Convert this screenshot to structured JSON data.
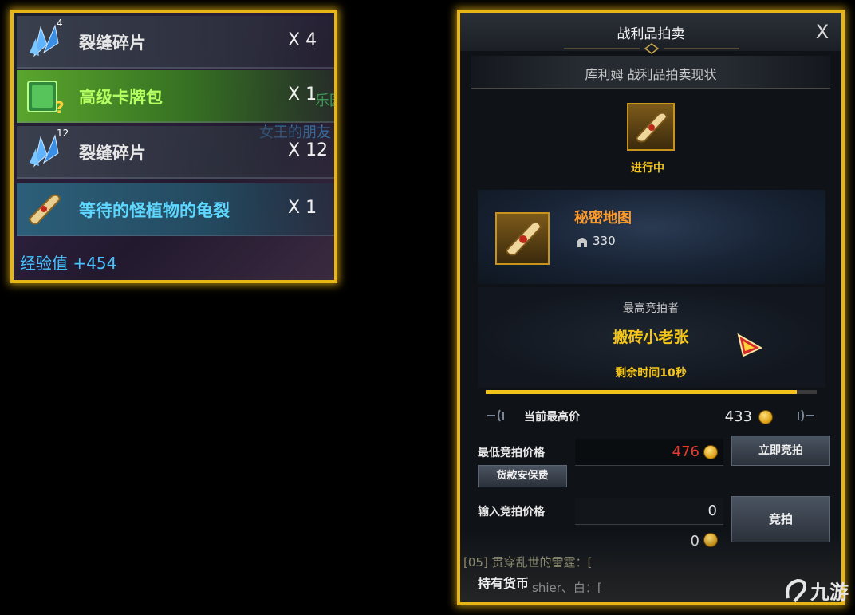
{
  "loot_panel": {
    "rows": [
      {
        "icon": "crystal-shard-icon",
        "badge": "4",
        "name": "裂缝碎片",
        "qty": "X 4"
      },
      {
        "icon": "card-pack-icon",
        "badge": "",
        "name": "高级卡牌包",
        "qty": "X 1"
      },
      {
        "icon": "crystal-shard-icon",
        "badge": "12",
        "name": "裂缝碎片",
        "qty": "X 12"
      },
      {
        "icon": "scroll-icon",
        "badge": "",
        "name": "等待的怪植物的龟裂",
        "qty": "X 1"
      }
    ],
    "exp": "经验值 +454",
    "bg_text": {
      "green": "乐园",
      "cyan": "女王的朋友"
    }
  },
  "auction": {
    "title": "战利品拍卖",
    "close": "X",
    "subtitle": "库利姆 战利品拍卖现状",
    "status": "进行中",
    "item_name": "秘密地图",
    "item_level": "330",
    "top_bidder_label": "最高竞拍者",
    "top_bidder_name": "搬砖小老张",
    "time_left": "剩余时间10秒",
    "progress": 0.94,
    "current_top_label": "当前最高价",
    "current_top_value": "433",
    "min_bid_label": "最低竞拍价格",
    "min_bid_value": "476",
    "bid_now_button": "立即竞拍",
    "fee_button": "货款安保费",
    "input_label": "输入竞拍价格",
    "input_value": "0",
    "cost_value": "0",
    "bid_button": "竞拍",
    "currency_label": "持有货币",
    "chat_lines": [
      "[05] 贯穿乱世的雷霆：[",
      "shier、白：["
    ]
  },
  "watermark": "九游",
  "colors": {
    "frame_gold": "#e8b517",
    "price_red": "#e53a2e",
    "bidder_gold": "#f5c518",
    "item_orange": "#ff9b2a"
  }
}
